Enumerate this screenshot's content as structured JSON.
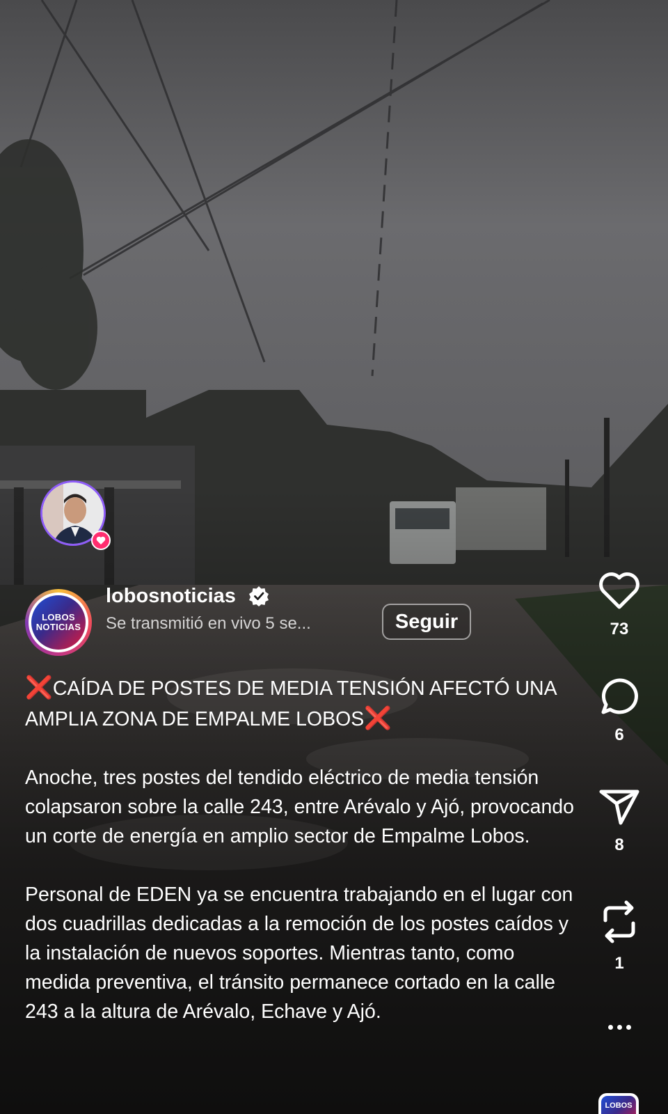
{
  "post": {
    "username": "lobosnoticias",
    "subtitle": "Se transmitió en vivo 5 se...",
    "follow_label": "Seguir",
    "logo_line1": "LOBOS",
    "logo_line2": "NOTICIAS"
  },
  "caption": {
    "headline_mark": "❌",
    "headline": "CAÍDA DE POSTES DE MEDIA TENSIÓN AFECTÓ UNA AMPLIA ZONA DE EMPALME LOBOS",
    "paragraph1": "Anoche, tres postes del tendido eléctrico de media tensión colapsaron sobre la calle 243, entre Arévalo y Ajó, provocando un corte de energía en amplio sector de Empalme Lobos.",
    "paragraph2": "Personal de EDEN ya se encuentra trabajando en el lugar con dos cuadrillas dedicadas a la remoción de los postes caídos y la instalación de nuevos soportes. Mientras tanto, como medida preventiva, el tránsito permanece cortado en la calle 243 a la altura de Arévalo, Echave y Ajó."
  },
  "actions": {
    "likes": "73",
    "comments": "6",
    "shares": "8",
    "reposts": "1"
  },
  "icons": {
    "like": "heart-icon",
    "comment": "comment-bubble-icon",
    "share": "paper-plane-icon",
    "repost": "repost-icon",
    "more": "more-dots-icon",
    "verified": "verified-badge-icon"
  },
  "colors": {
    "cross_mark": "#e0202a",
    "live_ring": "#8e5cf7",
    "heart_badge": "#ff2d6f"
  },
  "mini_logo_text": "LOBOS"
}
